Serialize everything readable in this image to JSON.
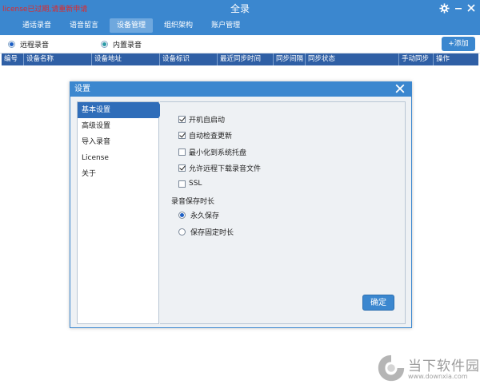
{
  "window": {
    "title": "全录",
    "license_warning": "license已过期,请重新申请"
  },
  "tabs": [
    {
      "label": "通话录音",
      "active": false
    },
    {
      "label": "语音留言",
      "active": false
    },
    {
      "label": "设备管理",
      "active": true
    },
    {
      "label": "组织架构",
      "active": false
    },
    {
      "label": "账户管理",
      "active": false
    }
  ],
  "modes": {
    "remote": "远程录音",
    "builtin": "内置录音",
    "selected": "remote"
  },
  "add_button": "+添加",
  "table": {
    "columns": [
      "编号",
      "设备名称",
      "设备地址",
      "设备标识",
      "最近同步时间",
      "同步间隔",
      "同步状态",
      "手动同步",
      "操作"
    ]
  },
  "dialog": {
    "title": "设置",
    "sidebar": [
      "基本设置",
      "高级设置",
      "导入录音",
      "License",
      "关于"
    ],
    "active_item": "基本设置",
    "options": [
      {
        "label": "开机自启动",
        "checked": true
      },
      {
        "label": "自动检查更新",
        "checked": true
      },
      {
        "label": "最小化到系统托盘",
        "checked": false
      },
      {
        "label": "允许远程下载录音文件",
        "checked": true
      },
      {
        "label": "SSL",
        "checked": false
      }
    ],
    "retention_label": "录音保存时长",
    "retention_options": [
      {
        "label": "永久保存",
        "selected": true
      },
      {
        "label": "保存固定时长",
        "selected": false
      }
    ],
    "ok_button": "确定"
  },
  "watermark": {
    "name": "当下软件园",
    "url": "www.downxia.com"
  },
  "colors": {
    "titlebar": "#3b87cf",
    "table_header": "#2f5fa5",
    "warning": "#e32727"
  }
}
